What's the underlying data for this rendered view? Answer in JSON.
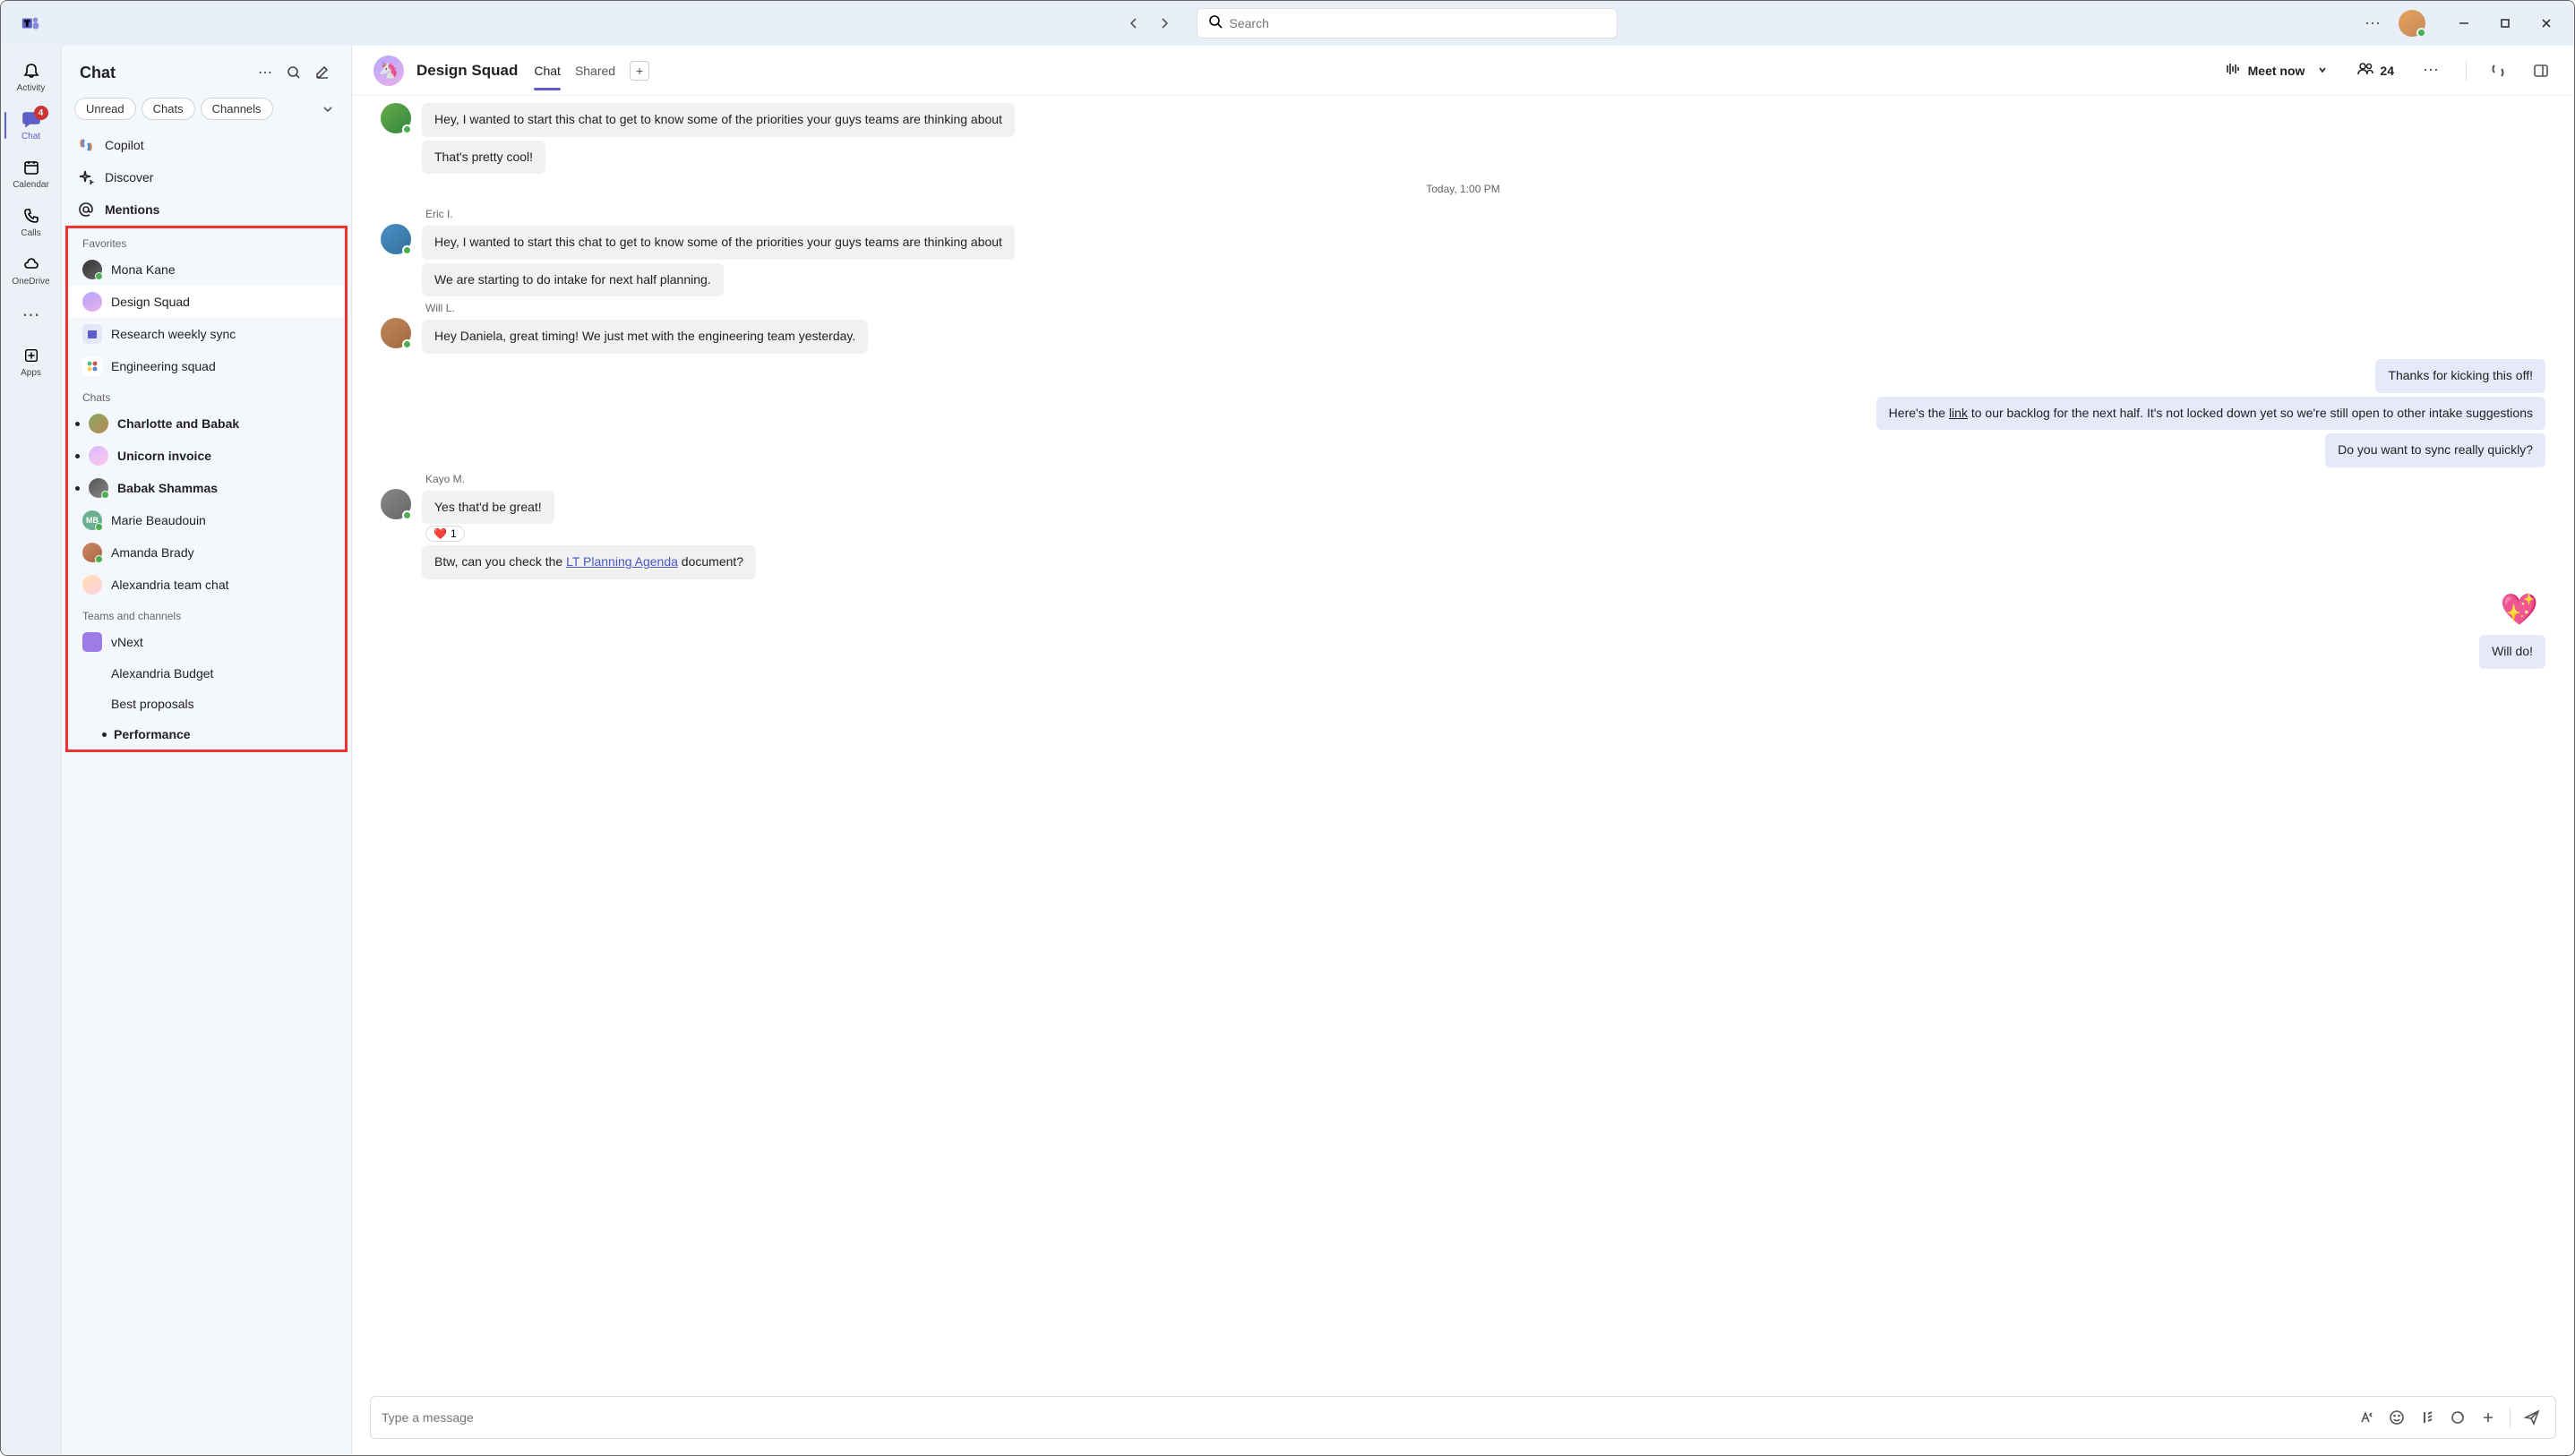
{
  "search": {
    "placeholder": "Search"
  },
  "rail": {
    "activity": "Activity",
    "chat": "Chat",
    "chat_badge": "4",
    "calendar": "Calendar",
    "calls": "Calls",
    "onedrive": "OneDrive",
    "apps": "Apps"
  },
  "chatlist": {
    "title": "Chat",
    "filters": {
      "unread": "Unread",
      "chats": "Chats",
      "channels": "Channels"
    },
    "quick": {
      "copilot": "Copilot",
      "discover": "Discover",
      "mentions": "Mentions"
    },
    "favorites_label": "Favorites",
    "favorites": [
      {
        "name": "Mona Kane"
      },
      {
        "name": "Design Squad"
      },
      {
        "name": "Research weekly sync"
      },
      {
        "name": "Engineering squad"
      }
    ],
    "chats_label": "Chats",
    "chats": [
      {
        "name": "Charlotte and Babak",
        "unread": true
      },
      {
        "name": "Unicorn invoice",
        "unread": true
      },
      {
        "name": "Babak Shammas",
        "unread": true
      },
      {
        "name": "Marie Beaudouin",
        "initials": "MB",
        "unread": false
      },
      {
        "name": "Amanda Brady",
        "unread": false
      },
      {
        "name": "Alexandria team chat",
        "unread": false
      }
    ],
    "teams_label": "Teams and channels",
    "teams": [
      {
        "name": "vNext"
      },
      {
        "name": "Alexandria Budget"
      },
      {
        "name": "Best proposals"
      },
      {
        "name": "Performance",
        "unread": true
      }
    ]
  },
  "convo": {
    "title": "Design Squad",
    "tabs": {
      "chat": "Chat",
      "shared": "Shared"
    },
    "meet": "Meet now",
    "people": "24",
    "divider": "Today, 1:00 PM",
    "messages": {
      "m0a": "Hey, I wanted to start this chat to get to know some of the priorities your guys teams are thinking about",
      "m0b": "That's pretty cool!",
      "s1": "Eric I.",
      "m1a": "Hey, I wanted to start this chat to get to know some of the priorities your guys teams are thinking about",
      "m1b": "We are starting to do intake for next half planning.",
      "s2": "Will L.",
      "m2": "Hey Daniela, great timing! We just met with the engineering team yesterday.",
      "me1": "Thanks for kicking this off!",
      "me2a": "Here's the ",
      "me2link": "link",
      "me2b": " to our backlog for the next half. It's not locked down yet so we're still open to other intake suggestions",
      "me3": "Do you want to sync really quickly?",
      "s3": "Kayo M.",
      "m3a": "Yes that'd be great!",
      "r3": "1",
      "m3b_pre": "Btw, can you check the ",
      "m3b_link": "LT Planning Agenda",
      "m3b_post": " document?",
      "me4": "Will do!"
    },
    "composer_placeholder": "Type a message"
  }
}
